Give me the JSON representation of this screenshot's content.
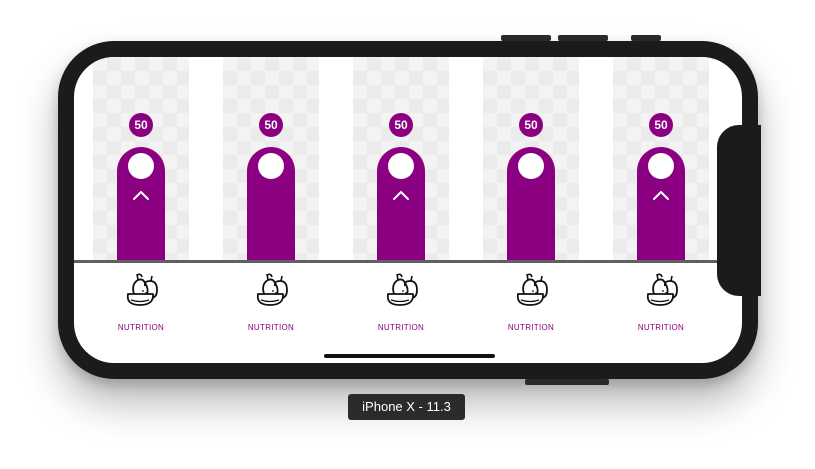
{
  "device": {
    "label": "iPhone X - 11.3"
  },
  "theme": {
    "accent": "#8b0080",
    "baseline": "#606060",
    "bezel": "#1b1b1b"
  },
  "columns": [
    {
      "value": "50",
      "label": "NUTRITION",
      "icon": "fruit-icon",
      "show_chevron": true
    },
    {
      "value": "50",
      "label": "NUTRITION",
      "icon": "fruit-icon",
      "show_chevron": false
    },
    {
      "value": "50",
      "label": "NUTRITION",
      "icon": "fruit-icon",
      "show_chevron": true
    },
    {
      "value": "50",
      "label": "NUTRITION",
      "icon": "fruit-icon",
      "show_chevron": false
    },
    {
      "value": "50",
      "label": "NUTRITION",
      "icon": "fruit-icon",
      "show_chevron": true
    }
  ]
}
